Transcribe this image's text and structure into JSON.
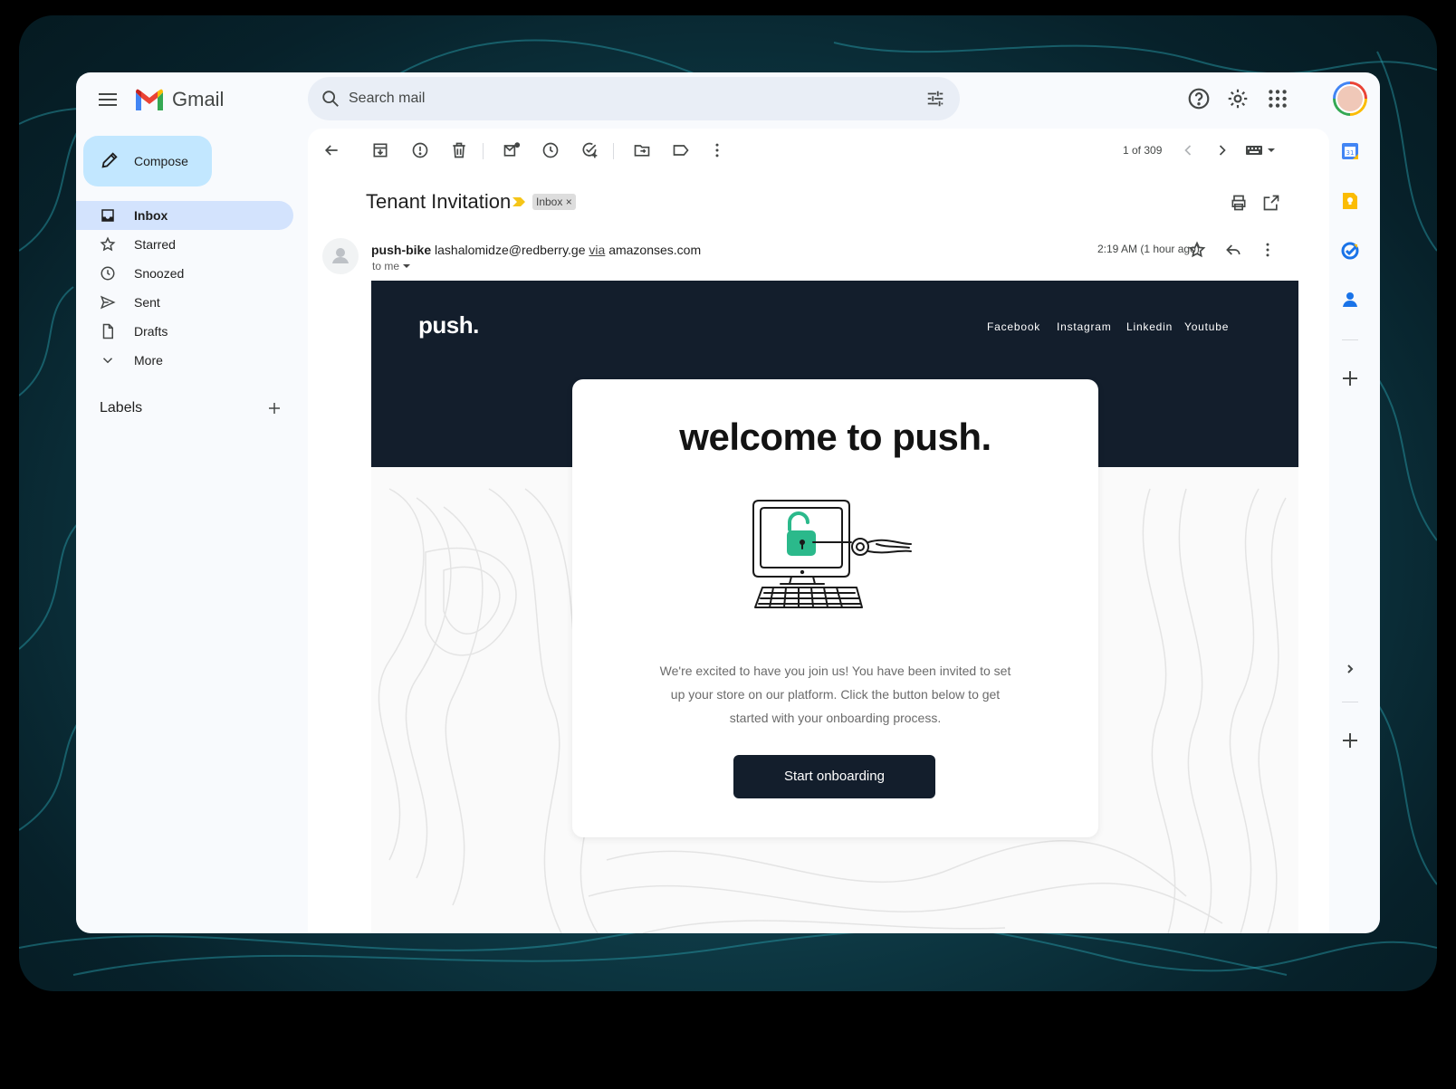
{
  "app": {
    "name": "Gmail"
  },
  "search": {
    "placeholder": "Search mail"
  },
  "sidebar": {
    "compose_label": "Compose",
    "items": [
      {
        "label": "Inbox"
      },
      {
        "label": "Starred"
      },
      {
        "label": "Snoozed"
      },
      {
        "label": "Sent"
      },
      {
        "label": "Drafts"
      },
      {
        "label": "More"
      }
    ],
    "labels_title": "Labels"
  },
  "toolbar": {
    "pager": "1 of 309"
  },
  "message": {
    "subject": "Tenant Invitation",
    "chip": "Inbox",
    "sender_name": "push-bike",
    "sender_email": "lashalomidze@redberry.ge",
    "via": "via",
    "via_domain": "amazonses.com",
    "to": "to me",
    "time": "2:19 AM (1 hour ago)"
  },
  "email": {
    "logo": "push.",
    "social": [
      "Facebook",
      "Instagram",
      "Linkedin",
      "Youtube"
    ],
    "headline": "welcome to push.",
    "body": "We're excited to have you join us! You have been invited to set up your store on our platform. Click the button below to get started with your onboarding process.",
    "cta": "Start onboarding"
  },
  "colors": {
    "compose_bg": "#c2e7ff",
    "active_nav": "#d3e3fd",
    "banner": "#131e2c",
    "lock_green": "#2bb98b"
  }
}
